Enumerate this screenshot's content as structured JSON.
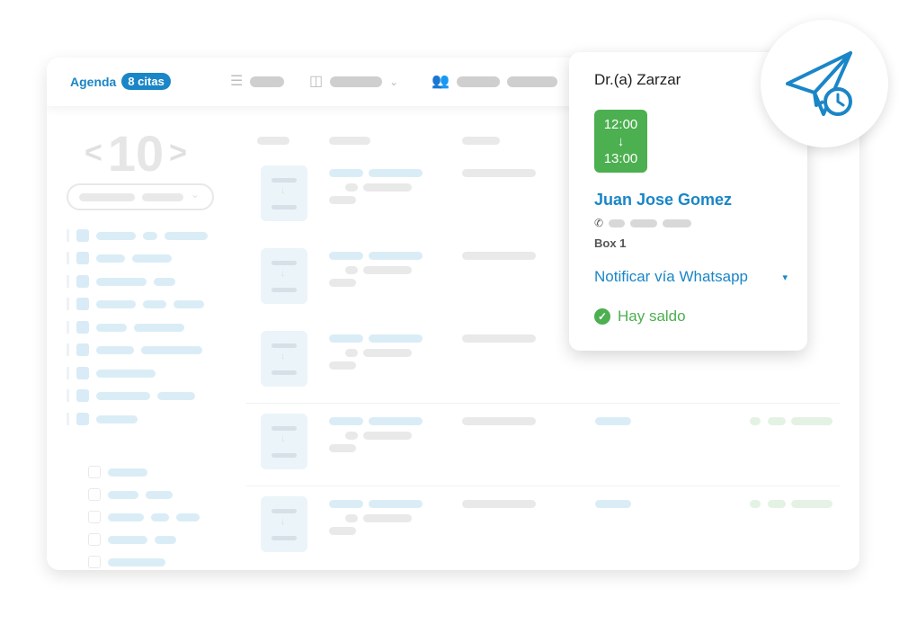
{
  "header": {
    "title": "Agenda",
    "badge": "8 citas",
    "icons": [
      "list-icon",
      "columns-icon",
      "chevron-down-icon",
      "users-icon"
    ]
  },
  "calendar": {
    "prev_arrow": "<",
    "day": "10",
    "next_arrow": ">"
  },
  "popover": {
    "doctor": "Dr.(a) Zarzar",
    "time_start": "12:00",
    "time_arrow": "↓",
    "time_end": "13:00",
    "patient_name": "Juan Jose Gomez",
    "room": "Box 1",
    "notify_label": "Notificar vía Whatsapp",
    "balance_status": "Hay saldo"
  },
  "colors": {
    "accent": "#1a86c7",
    "success": "#4caf50"
  },
  "send_icon": "paper-plane-clock-icon"
}
